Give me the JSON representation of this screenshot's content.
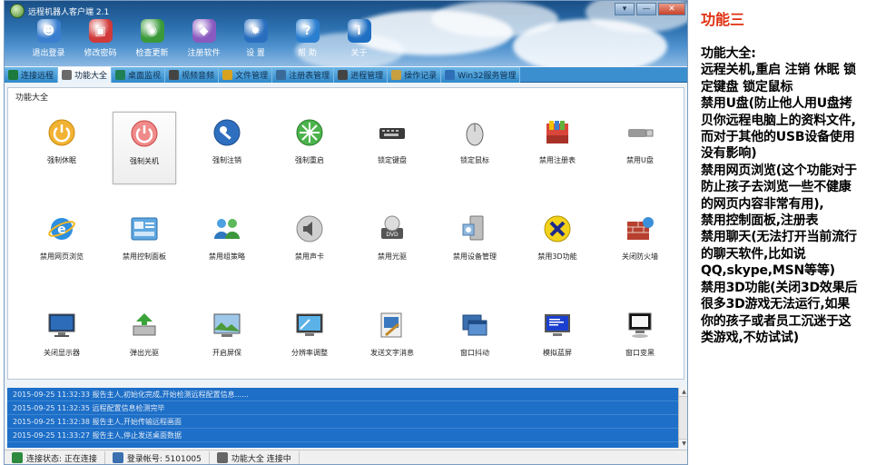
{
  "window": {
    "title": "远程机器人客户端 2.1",
    "controls": [
      "▾",
      "—",
      "✕"
    ]
  },
  "toolbar": [
    {
      "label": "退出登录",
      "icon": "users-icon",
      "color": "#3a7fcf"
    },
    {
      "label": "修改密码",
      "icon": "lock-icon",
      "color": "#d03a3a"
    },
    {
      "label": "检查更新",
      "icon": "globe-icon",
      "color": "#3a9a3a"
    },
    {
      "label": "注册软件",
      "icon": "cube-icon",
      "color": "#8a5ac0"
    },
    {
      "label": "设 置",
      "icon": "gear-icon",
      "color": "#2a6fbf"
    },
    {
      "label": "帮 助",
      "icon": "help-icon",
      "color": "#2b7fd0"
    },
    {
      "label": "关于",
      "icon": "info-icon",
      "color": "#1f6fc2"
    }
  ],
  "tabs": [
    {
      "label": "连接远程",
      "icon": "network-icon",
      "color": "#1c7a3c"
    },
    {
      "label": "功能大全",
      "icon": "tools-icon",
      "color": "#6a6a6a",
      "active": true
    },
    {
      "label": "桌面监视",
      "icon": "monitor-icon",
      "color": "#1f7f55"
    },
    {
      "label": "视频音频",
      "icon": "camera-icon",
      "color": "#444444"
    },
    {
      "label": "文件管理",
      "icon": "folder-icon",
      "color": "#d8a21f"
    },
    {
      "label": "注册表管理",
      "icon": "registry-icon",
      "color": "#3a6a9a"
    },
    {
      "label": "进程管理",
      "icon": "process-icon",
      "color": "#444444"
    },
    {
      "label": "操作记录",
      "icon": "log-icon",
      "color": "#c8a040"
    },
    {
      "label": "Win32服务管理",
      "icon": "search-icon",
      "color": "#2f6fb8"
    }
  ],
  "panel": {
    "title": "功能大全",
    "features": [
      {
        "label": "强制休眠",
        "icon": "sleep-icon"
      },
      {
        "label": "强制关机",
        "icon": "shutdown-icon",
        "selected": true
      },
      {
        "label": "强制注销",
        "icon": "logoff-key-icon"
      },
      {
        "label": "强制重启",
        "icon": "restart-icon"
      },
      {
        "label": "锁定键盘",
        "icon": "keyboard-icon"
      },
      {
        "label": "锁定鼠标",
        "icon": "mouse-icon"
      },
      {
        "label": "禁用注册表",
        "icon": "registry-icon"
      },
      {
        "label": "禁用U盘",
        "icon": "usb-icon"
      },
      {
        "label": "禁用网页浏览",
        "icon": "ie-icon"
      },
      {
        "label": "禁用控制面板",
        "icon": "control-panel-icon"
      },
      {
        "label": "禁用组策略",
        "icon": "group-policy-icon"
      },
      {
        "label": "禁用声卡",
        "icon": "speaker-icon"
      },
      {
        "label": "禁用光驱",
        "icon": "dvd-icon"
      },
      {
        "label": "禁用设备管理",
        "icon": "device-manager-icon"
      },
      {
        "label": "禁用3D功能",
        "icon": "directx-icon"
      },
      {
        "label": "关闭防火墙",
        "icon": "firewall-icon"
      },
      {
        "label": "关闭显示器",
        "icon": "display-icon"
      },
      {
        "label": "弹出光驱",
        "icon": "eject-icon"
      },
      {
        "label": "开启屏保",
        "icon": "screensaver-icon"
      },
      {
        "label": "分辨率调整",
        "icon": "resolution-icon"
      },
      {
        "label": "发送文字消息",
        "icon": "message-icon"
      },
      {
        "label": "窗口抖动",
        "icon": "window-shake-icon"
      },
      {
        "label": "模拟蓝屏",
        "icon": "bluescreen-icon"
      },
      {
        "label": "窗口变黑",
        "icon": "window-black-icon"
      }
    ]
  },
  "log": [
    "2015-09-25 11:32:33 报告主人,初始化完成,开始检测远程配置信息......",
    "2015-09-25 11:32:35 远程配置信息检测完毕",
    "2015-09-25 11:32:38 报告主人,开始传输远程画面",
    "2015-09-25 11:33:27 报告主人,停止发送桌面数据"
  ],
  "status": [
    {
      "label": "连接状态: 正在连接",
      "icon": "network-status-icon"
    },
    {
      "label": "登录帐号: 5101005",
      "icon": "account-icon"
    },
    {
      "label": "功能大全 连接中",
      "icon": "tools-icon"
    }
  ],
  "side": {
    "heading": "功能三",
    "lines": [
      "功能大全:",
      "远程关机,重启 注销 休眠 锁",
      "定键盘 锁定鼠标",
      "禁用U盘(防止他人用U盘拷",
      "贝你远程电脑上的资料文件,",
      "而对于其他的USB设备使用",
      "没有影响)",
      "禁用网页浏览(这个功能对于",
      "防止孩子去浏览一些不健康",
      "的网页内容非常有用),",
      "禁用控制面板,注册表",
      "禁用聊天(无法打开当前流行",
      "的聊天软件,比如说",
      "QQ,skype,MSN等等)",
      "禁用3D功能(关闭3D效果后",
      "很多3D游戏无法运行,如果",
      "你的孩子或者员工沉迷于这",
      "类游戏,不妨试试)"
    ]
  }
}
